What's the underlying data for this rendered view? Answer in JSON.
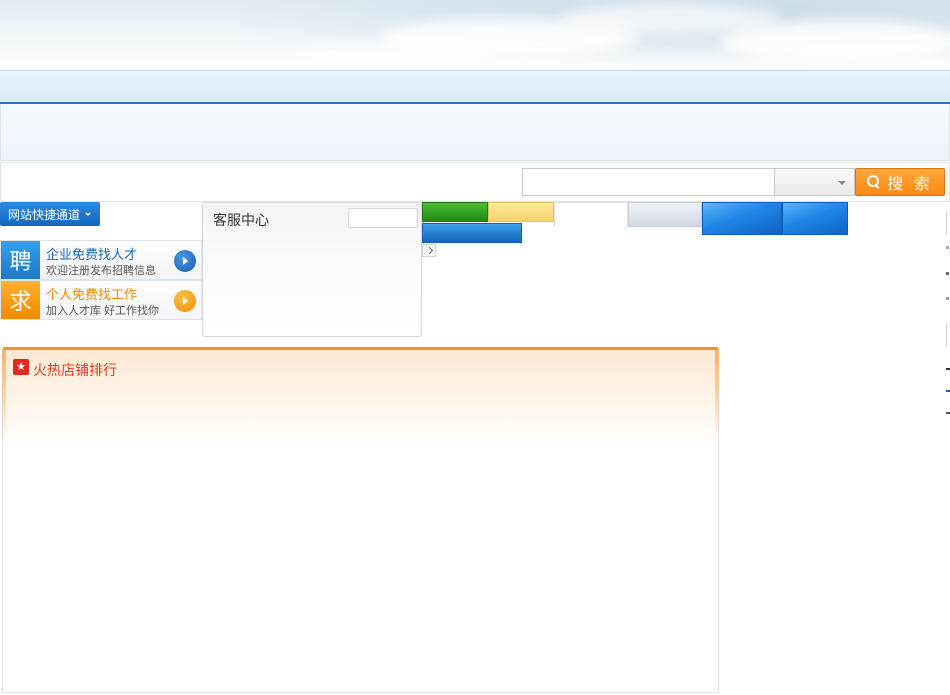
{
  "search": {
    "input_value": "",
    "input_placeholder": "",
    "select_value": "",
    "button_label": "搜 索"
  },
  "quick_nav": {
    "label": "网站快捷通道"
  },
  "promos": [
    {
      "badge": "聘",
      "title": "企业免费找人才",
      "subtitle": "欢迎注册发布招聘信息"
    },
    {
      "badge": "求",
      "title": "个人免费找工作",
      "subtitle": "加入人才库  好工作找你"
    }
  ],
  "service": {
    "title": "客服中心",
    "search_value": ""
  },
  "hot_ranking": {
    "icon": "star-icon",
    "title": "火热店铺排行"
  },
  "colors": {
    "nav_border": "#2a76b5",
    "search_button": "#ff8a12",
    "quick_nav": "#1b74cc",
    "promo_blue": "#1d78c6",
    "promo_orange": "#f08a00",
    "hot_panel_border": "#f7941d",
    "hot_title": "#e0401a"
  }
}
